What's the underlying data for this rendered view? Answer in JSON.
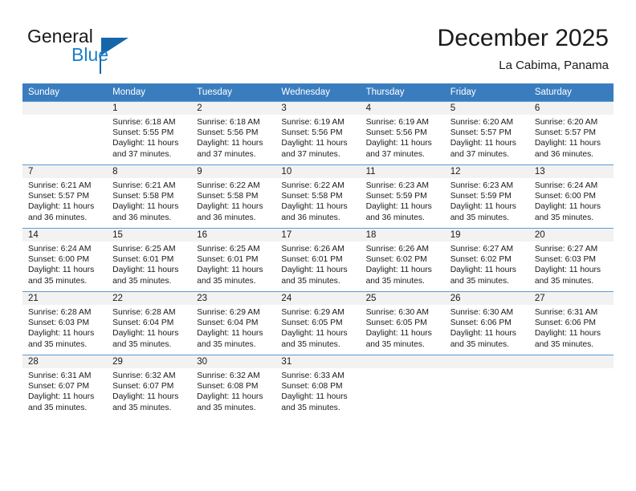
{
  "brand": {
    "name_part1": "General",
    "name_part2": "Blue",
    "triangle_color": "#1566a8",
    "blue_color": "#1f7ec4"
  },
  "header": {
    "title": "December 2025",
    "subtitle": "La Cabima, Panama"
  },
  "theme": {
    "header_row_bg": "#3a7dbf",
    "daynum_bg": "#f2f2f2",
    "grid_line": "#5b9bd5",
    "text": "#1a1a1a"
  },
  "weekday_headers": [
    "Sunday",
    "Monday",
    "Tuesday",
    "Wednesday",
    "Thursday",
    "Friday",
    "Saturday"
  ],
  "weeks": [
    [
      {
        "day": "",
        "sunrise": "",
        "sunset": "",
        "daylight_line1": "",
        "daylight_line2": "",
        "empty": true
      },
      {
        "day": "1",
        "sunrise": "Sunrise: 6:18 AM",
        "sunset": "Sunset: 5:55 PM",
        "daylight_line1": "Daylight: 11 hours",
        "daylight_line2": "and 37 minutes.",
        "empty": false
      },
      {
        "day": "2",
        "sunrise": "Sunrise: 6:18 AM",
        "sunset": "Sunset: 5:56 PM",
        "daylight_line1": "Daylight: 11 hours",
        "daylight_line2": "and 37 minutes.",
        "empty": false
      },
      {
        "day": "3",
        "sunrise": "Sunrise: 6:19 AM",
        "sunset": "Sunset: 5:56 PM",
        "daylight_line1": "Daylight: 11 hours",
        "daylight_line2": "and 37 minutes.",
        "empty": false
      },
      {
        "day": "4",
        "sunrise": "Sunrise: 6:19 AM",
        "sunset": "Sunset: 5:56 PM",
        "daylight_line1": "Daylight: 11 hours",
        "daylight_line2": "and 37 minutes.",
        "empty": false
      },
      {
        "day": "5",
        "sunrise": "Sunrise: 6:20 AM",
        "sunset": "Sunset: 5:57 PM",
        "daylight_line1": "Daylight: 11 hours",
        "daylight_line2": "and 37 minutes.",
        "empty": false
      },
      {
        "day": "6",
        "sunrise": "Sunrise: 6:20 AM",
        "sunset": "Sunset: 5:57 PM",
        "daylight_line1": "Daylight: 11 hours",
        "daylight_line2": "and 36 minutes.",
        "empty": false
      }
    ],
    [
      {
        "day": "7",
        "sunrise": "Sunrise: 6:21 AM",
        "sunset": "Sunset: 5:57 PM",
        "daylight_line1": "Daylight: 11 hours",
        "daylight_line2": "and 36 minutes.",
        "empty": false
      },
      {
        "day": "8",
        "sunrise": "Sunrise: 6:21 AM",
        "sunset": "Sunset: 5:58 PM",
        "daylight_line1": "Daylight: 11 hours",
        "daylight_line2": "and 36 minutes.",
        "empty": false
      },
      {
        "day": "9",
        "sunrise": "Sunrise: 6:22 AM",
        "sunset": "Sunset: 5:58 PM",
        "daylight_line1": "Daylight: 11 hours",
        "daylight_line2": "and 36 minutes.",
        "empty": false
      },
      {
        "day": "10",
        "sunrise": "Sunrise: 6:22 AM",
        "sunset": "Sunset: 5:58 PM",
        "daylight_line1": "Daylight: 11 hours",
        "daylight_line2": "and 36 minutes.",
        "empty": false
      },
      {
        "day": "11",
        "sunrise": "Sunrise: 6:23 AM",
        "sunset": "Sunset: 5:59 PM",
        "daylight_line1": "Daylight: 11 hours",
        "daylight_line2": "and 36 minutes.",
        "empty": false
      },
      {
        "day": "12",
        "sunrise": "Sunrise: 6:23 AM",
        "sunset": "Sunset: 5:59 PM",
        "daylight_line1": "Daylight: 11 hours",
        "daylight_line2": "and 35 minutes.",
        "empty": false
      },
      {
        "day": "13",
        "sunrise": "Sunrise: 6:24 AM",
        "sunset": "Sunset: 6:00 PM",
        "daylight_line1": "Daylight: 11 hours",
        "daylight_line2": "and 35 minutes.",
        "empty": false
      }
    ],
    [
      {
        "day": "14",
        "sunrise": "Sunrise: 6:24 AM",
        "sunset": "Sunset: 6:00 PM",
        "daylight_line1": "Daylight: 11 hours",
        "daylight_line2": "and 35 minutes.",
        "empty": false
      },
      {
        "day": "15",
        "sunrise": "Sunrise: 6:25 AM",
        "sunset": "Sunset: 6:01 PM",
        "daylight_line1": "Daylight: 11 hours",
        "daylight_line2": "and 35 minutes.",
        "empty": false
      },
      {
        "day": "16",
        "sunrise": "Sunrise: 6:25 AM",
        "sunset": "Sunset: 6:01 PM",
        "daylight_line1": "Daylight: 11 hours",
        "daylight_line2": "and 35 minutes.",
        "empty": false
      },
      {
        "day": "17",
        "sunrise": "Sunrise: 6:26 AM",
        "sunset": "Sunset: 6:01 PM",
        "daylight_line1": "Daylight: 11 hours",
        "daylight_line2": "and 35 minutes.",
        "empty": false
      },
      {
        "day": "18",
        "sunrise": "Sunrise: 6:26 AM",
        "sunset": "Sunset: 6:02 PM",
        "daylight_line1": "Daylight: 11 hours",
        "daylight_line2": "and 35 minutes.",
        "empty": false
      },
      {
        "day": "19",
        "sunrise": "Sunrise: 6:27 AM",
        "sunset": "Sunset: 6:02 PM",
        "daylight_line1": "Daylight: 11 hours",
        "daylight_line2": "and 35 minutes.",
        "empty": false
      },
      {
        "day": "20",
        "sunrise": "Sunrise: 6:27 AM",
        "sunset": "Sunset: 6:03 PM",
        "daylight_line1": "Daylight: 11 hours",
        "daylight_line2": "and 35 minutes.",
        "empty": false
      }
    ],
    [
      {
        "day": "21",
        "sunrise": "Sunrise: 6:28 AM",
        "sunset": "Sunset: 6:03 PM",
        "daylight_line1": "Daylight: 11 hours",
        "daylight_line2": "and 35 minutes.",
        "empty": false
      },
      {
        "day": "22",
        "sunrise": "Sunrise: 6:28 AM",
        "sunset": "Sunset: 6:04 PM",
        "daylight_line1": "Daylight: 11 hours",
        "daylight_line2": "and 35 minutes.",
        "empty": false
      },
      {
        "day": "23",
        "sunrise": "Sunrise: 6:29 AM",
        "sunset": "Sunset: 6:04 PM",
        "daylight_line1": "Daylight: 11 hours",
        "daylight_line2": "and 35 minutes.",
        "empty": false
      },
      {
        "day": "24",
        "sunrise": "Sunrise: 6:29 AM",
        "sunset": "Sunset: 6:05 PM",
        "daylight_line1": "Daylight: 11 hours",
        "daylight_line2": "and 35 minutes.",
        "empty": false
      },
      {
        "day": "25",
        "sunrise": "Sunrise: 6:30 AM",
        "sunset": "Sunset: 6:05 PM",
        "daylight_line1": "Daylight: 11 hours",
        "daylight_line2": "and 35 minutes.",
        "empty": false
      },
      {
        "day": "26",
        "sunrise": "Sunrise: 6:30 AM",
        "sunset": "Sunset: 6:06 PM",
        "daylight_line1": "Daylight: 11 hours",
        "daylight_line2": "and 35 minutes.",
        "empty": false
      },
      {
        "day": "27",
        "sunrise": "Sunrise: 6:31 AM",
        "sunset": "Sunset: 6:06 PM",
        "daylight_line1": "Daylight: 11 hours",
        "daylight_line2": "and 35 minutes.",
        "empty": false
      }
    ],
    [
      {
        "day": "28",
        "sunrise": "Sunrise: 6:31 AM",
        "sunset": "Sunset: 6:07 PM",
        "daylight_line1": "Daylight: 11 hours",
        "daylight_line2": "and 35 minutes.",
        "empty": false
      },
      {
        "day": "29",
        "sunrise": "Sunrise: 6:32 AM",
        "sunset": "Sunset: 6:07 PM",
        "daylight_line1": "Daylight: 11 hours",
        "daylight_line2": "and 35 minutes.",
        "empty": false
      },
      {
        "day": "30",
        "sunrise": "Sunrise: 6:32 AM",
        "sunset": "Sunset: 6:08 PM",
        "daylight_line1": "Daylight: 11 hours",
        "daylight_line2": "and 35 minutes.",
        "empty": false
      },
      {
        "day": "31",
        "sunrise": "Sunrise: 6:33 AM",
        "sunset": "Sunset: 6:08 PM",
        "daylight_line1": "Daylight: 11 hours",
        "daylight_line2": "and 35 minutes.",
        "empty": false
      },
      {
        "day": "",
        "sunrise": "",
        "sunset": "",
        "daylight_line1": "",
        "daylight_line2": "",
        "empty": true
      },
      {
        "day": "",
        "sunrise": "",
        "sunset": "",
        "daylight_line1": "",
        "daylight_line2": "",
        "empty": true
      },
      {
        "day": "",
        "sunrise": "",
        "sunset": "",
        "daylight_line1": "",
        "daylight_line2": "",
        "empty": true
      }
    ]
  ]
}
